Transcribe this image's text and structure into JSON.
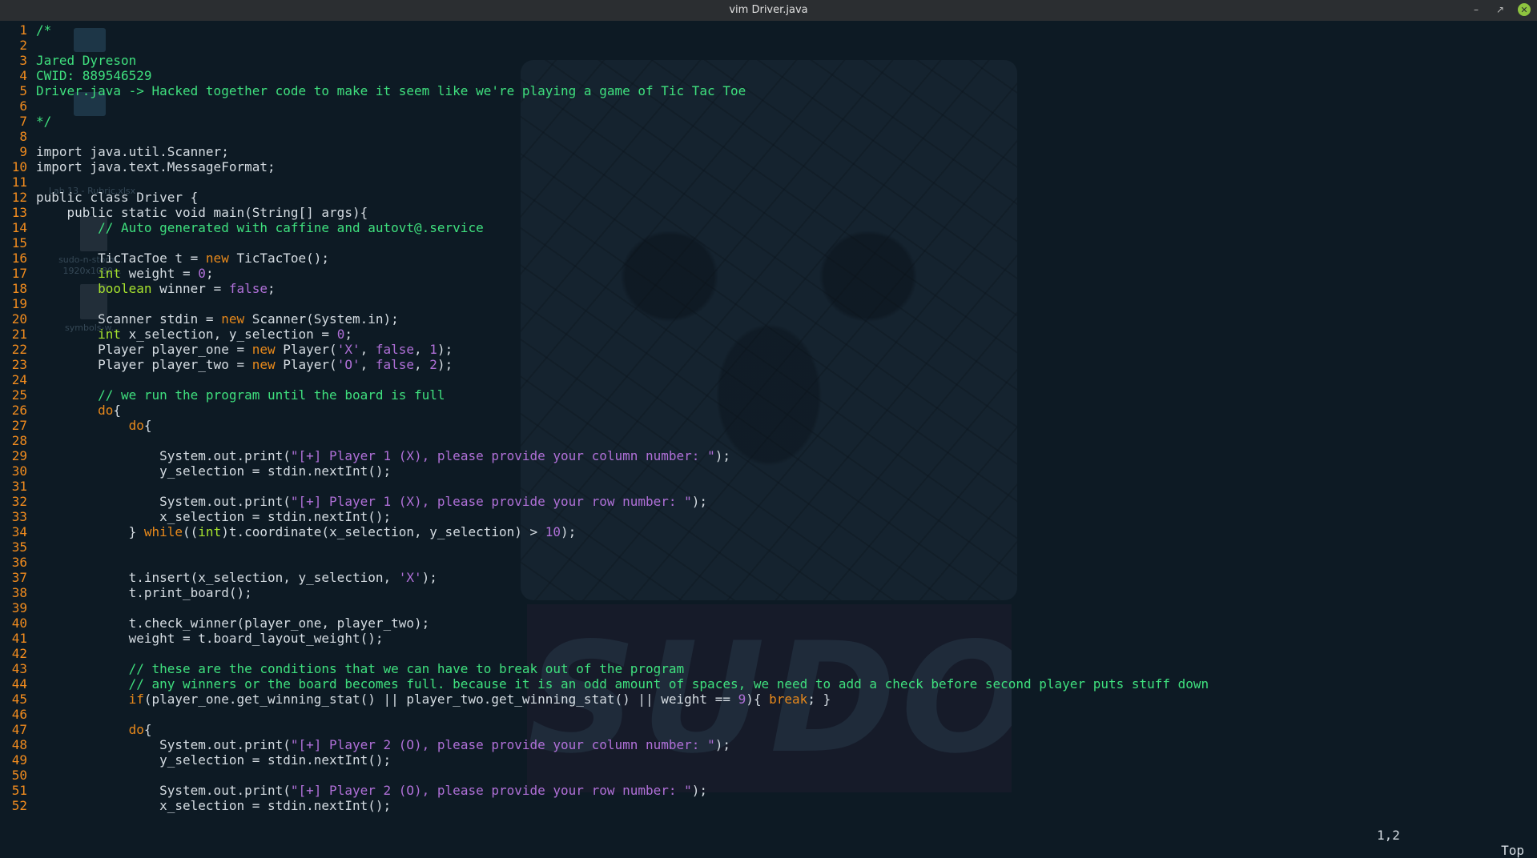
{
  "window": {
    "title": "vim Driver.java",
    "buttons": [
      "minimize",
      "maximize",
      "close"
    ]
  },
  "desktop_ghost": {
    "labels": [
      "Lab 13 - Rubric.xlsx",
      "sudo-n-storm...",
      "1920x1080...",
      "symbols-w..."
    ]
  },
  "wallpaper": {
    "word": "SUDO"
  },
  "editor": {
    "filename": "Driver.java",
    "lines": [
      {
        "num": "1",
        "segs": [
          [
            "c",
            "/*"
          ]
        ]
      },
      {
        "num": "2",
        "segs": []
      },
      {
        "num": "3",
        "segs": [
          [
            "c",
            "Jared Dyreson"
          ]
        ]
      },
      {
        "num": "4",
        "segs": [
          [
            "c",
            "CWID: 889546529"
          ]
        ]
      },
      {
        "num": "5",
        "segs": [
          [
            "c",
            "Driver.java -> Hacked together code to make it seem like we're playing a game of Tic Tac Toe"
          ]
        ]
      },
      {
        "num": "6",
        "segs": []
      },
      {
        "num": "7",
        "segs": [
          [
            "c",
            "*/"
          ]
        ]
      },
      {
        "num": "8",
        "segs": []
      },
      {
        "num": "9",
        "segs": [
          [
            "",
            "import java.util.Scanner;"
          ]
        ]
      },
      {
        "num": "10",
        "segs": [
          [
            "",
            "import java.text.MessageFormat;"
          ]
        ]
      },
      {
        "num": "11",
        "segs": []
      },
      {
        "num": "12",
        "segs": [
          [
            "",
            "public class Driver {"
          ]
        ]
      },
      {
        "num": "13",
        "segs": [
          [
            "",
            "    public static void main(String[] args){"
          ]
        ]
      },
      {
        "num": "14",
        "segs": [
          [
            "",
            "        "
          ],
          [
            "c",
            "// Auto generated with caffine and autovt@.service"
          ]
        ]
      },
      {
        "num": "15",
        "segs": []
      },
      {
        "num": "16",
        "segs": [
          [
            "",
            "        TicTacToe t = "
          ],
          [
            "k",
            "new"
          ],
          [
            "",
            " TicTacToe();"
          ]
        ]
      },
      {
        "num": "17",
        "segs": [
          [
            "",
            "        "
          ],
          [
            "t",
            "int"
          ],
          [
            "",
            " weight = "
          ],
          [
            "n",
            "0"
          ],
          [
            "",
            ";"
          ]
        ]
      },
      {
        "num": "18",
        "segs": [
          [
            "",
            "        "
          ],
          [
            "t",
            "boolean"
          ],
          [
            "",
            " winner = "
          ],
          [
            "n",
            "false"
          ],
          [
            "",
            ";"
          ]
        ]
      },
      {
        "num": "19",
        "segs": []
      },
      {
        "num": "20",
        "segs": [
          [
            "",
            "        Scanner stdin = "
          ],
          [
            "k",
            "new"
          ],
          [
            "",
            " Scanner(System.in);"
          ]
        ]
      },
      {
        "num": "21",
        "segs": [
          [
            "",
            "        "
          ],
          [
            "t",
            "int"
          ],
          [
            "",
            " x_selection, y_selection = "
          ],
          [
            "n",
            "0"
          ],
          [
            "",
            ";"
          ]
        ]
      },
      {
        "num": "22",
        "segs": [
          [
            "",
            "        Player player_one = "
          ],
          [
            "k",
            "new"
          ],
          [
            "",
            " Player("
          ],
          [
            "s",
            "'X'"
          ],
          [
            "",
            ", "
          ],
          [
            "n",
            "false"
          ],
          [
            "",
            ", "
          ],
          [
            "n",
            "1"
          ],
          [
            "",
            ");"
          ]
        ]
      },
      {
        "num": "23",
        "segs": [
          [
            "",
            "        Player player_two = "
          ],
          [
            "k",
            "new"
          ],
          [
            "",
            " Player("
          ],
          [
            "s",
            "'O'"
          ],
          [
            "",
            ", "
          ],
          [
            "n",
            "false"
          ],
          [
            "",
            ", "
          ],
          [
            "n",
            "2"
          ],
          [
            "",
            ");"
          ]
        ]
      },
      {
        "num": "24",
        "segs": []
      },
      {
        "num": "25",
        "segs": [
          [
            "",
            "        "
          ],
          [
            "c",
            "// we run the program until the board is full"
          ]
        ]
      },
      {
        "num": "26",
        "segs": [
          [
            "",
            "        "
          ],
          [
            "k",
            "do"
          ],
          [
            "",
            "{"
          ]
        ]
      },
      {
        "num": "27",
        "segs": [
          [
            "",
            "            "
          ],
          [
            "k",
            "do"
          ],
          [
            "",
            "{"
          ]
        ]
      },
      {
        "num": "28",
        "segs": []
      },
      {
        "num": "29",
        "segs": [
          [
            "",
            "                System.out.print("
          ],
          [
            "s",
            "\"[+] Player 1 (X), please provide your column number: \""
          ],
          [
            "",
            ");"
          ]
        ]
      },
      {
        "num": "30",
        "segs": [
          [
            "",
            "                y_selection = stdin.nextInt();"
          ]
        ]
      },
      {
        "num": "31",
        "segs": []
      },
      {
        "num": "32",
        "segs": [
          [
            "",
            "                System.out.print("
          ],
          [
            "s",
            "\"[+] Player 1 (X), please provide your row number: \""
          ],
          [
            "",
            ");"
          ]
        ]
      },
      {
        "num": "33",
        "segs": [
          [
            "",
            "                x_selection = stdin.nextInt();"
          ]
        ]
      },
      {
        "num": "34",
        "segs": [
          [
            "",
            "            } "
          ],
          [
            "k",
            "while"
          ],
          [
            "",
            "(("
          ],
          [
            "t",
            "int"
          ],
          [
            "",
            ")t.coordinate(x_selection, y_selection) > "
          ],
          [
            "n",
            "10"
          ],
          [
            "",
            ");"
          ]
        ]
      },
      {
        "num": "35",
        "segs": []
      },
      {
        "num": "36",
        "segs": []
      },
      {
        "num": "37",
        "segs": [
          [
            "",
            "            t.insert(x_selection, y_selection, "
          ],
          [
            "s",
            "'X'"
          ],
          [
            "",
            ");"
          ]
        ]
      },
      {
        "num": "38",
        "segs": [
          [
            "",
            "            t.print_board();"
          ]
        ]
      },
      {
        "num": "39",
        "segs": []
      },
      {
        "num": "40",
        "segs": [
          [
            "",
            "            t.check_winner(player_one, player_two);"
          ]
        ]
      },
      {
        "num": "41",
        "segs": [
          [
            "",
            "            weight = t.board_layout_weight();"
          ]
        ]
      },
      {
        "num": "42",
        "segs": []
      },
      {
        "num": "43",
        "segs": [
          [
            "",
            "            "
          ],
          [
            "c",
            "// these are the conditions that we can have to break out of the program"
          ]
        ]
      },
      {
        "num": "44",
        "segs": [
          [
            "",
            "            "
          ],
          [
            "c",
            "// any winners or the board becomes full. because it is an odd amount of spaces, we need to add a check before second player puts stuff down"
          ]
        ]
      },
      {
        "num": "45",
        "segs": [
          [
            "",
            "            "
          ],
          [
            "k",
            "if"
          ],
          [
            "",
            "(player_one.get_winning_stat() || player_two.get_winning_stat() || weight == "
          ],
          [
            "n",
            "9"
          ],
          [
            "",
            "){ "
          ],
          [
            "k",
            "break"
          ],
          [
            "",
            "; }"
          ]
        ]
      },
      {
        "num": "46",
        "segs": []
      },
      {
        "num": "47",
        "segs": [
          [
            "",
            "            "
          ],
          [
            "k",
            "do"
          ],
          [
            "",
            "{"
          ]
        ]
      },
      {
        "num": "48",
        "segs": [
          [
            "",
            "                System.out.print("
          ],
          [
            "s",
            "\"[+] Player 2 (O), please provide your column number: \""
          ],
          [
            "",
            ");"
          ]
        ]
      },
      {
        "num": "49",
        "segs": [
          [
            "",
            "                y_selection = stdin.nextInt();"
          ]
        ]
      },
      {
        "num": "50",
        "segs": []
      },
      {
        "num": "51",
        "segs": [
          [
            "",
            "                System.out.print("
          ],
          [
            "s",
            "\"[+] Player 2 (O), please provide your row number: \""
          ],
          [
            "",
            ");"
          ]
        ]
      },
      {
        "num": "52",
        "segs": [
          [
            "",
            "                x_selection = stdin.nextInt();"
          ]
        ]
      }
    ]
  },
  "statusline": {
    "position": "1,2",
    "scroll": "Top"
  },
  "colors": {
    "background": "#0d1a24",
    "line_numbers": "#f28c1e",
    "comment": "#3fe07e",
    "keyword": "#e8891b",
    "type": "#a6e22e",
    "string": "#b070d8",
    "text": "#d6dde3"
  }
}
